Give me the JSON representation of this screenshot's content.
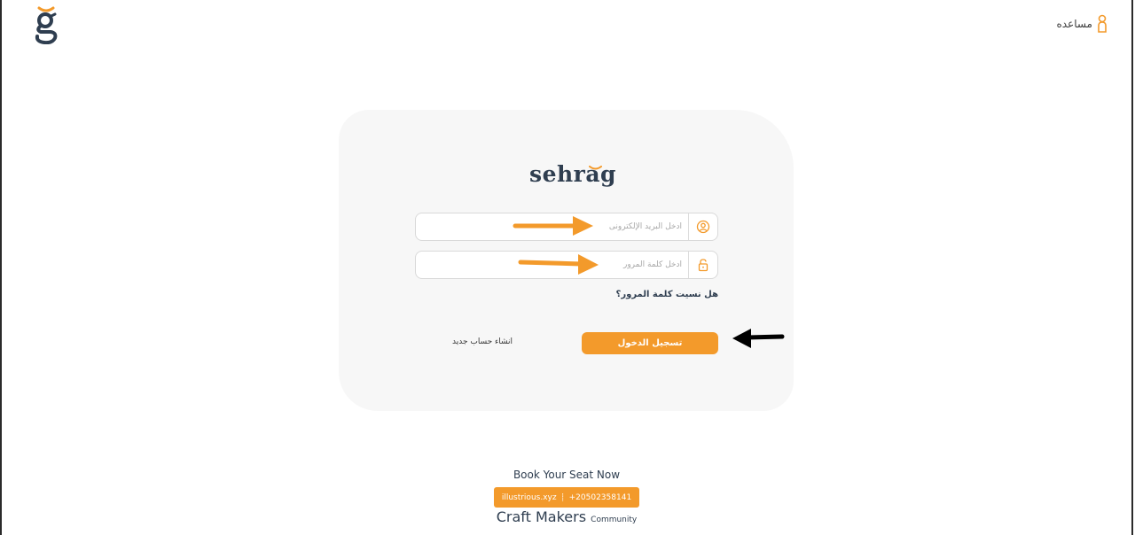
{
  "header": {
    "logo_icon": "sehrag-g-logo",
    "help_label": "مساعده",
    "help_icon": "person-icon"
  },
  "brand": {
    "name": "sehrag"
  },
  "login_form": {
    "email_placeholder": "أدخل البريد الإلكترونى",
    "email_icon": "user-circle-icon",
    "password_placeholder": "أدخل كلمة المرور",
    "password_icon": "lock-icon",
    "forgot_password": "هل نسيت كلمة المرور؟",
    "login_button": "تسجيل الدخول",
    "register_link": "انشاء حساب جديد"
  },
  "annotations": {
    "arrow_color_orange": "#f39a2b",
    "arrow_color_black": "#000000"
  },
  "footer": {
    "book_label": "Book Your Seat Now",
    "website": "illustrious.xyz",
    "phone": "+20502358141",
    "brand_main": "Craft Makers",
    "brand_sub": "Community"
  },
  "colors": {
    "accent": "#f39a2b",
    "navy": "#2f3e50",
    "card_bg": "#f7f7f7"
  }
}
